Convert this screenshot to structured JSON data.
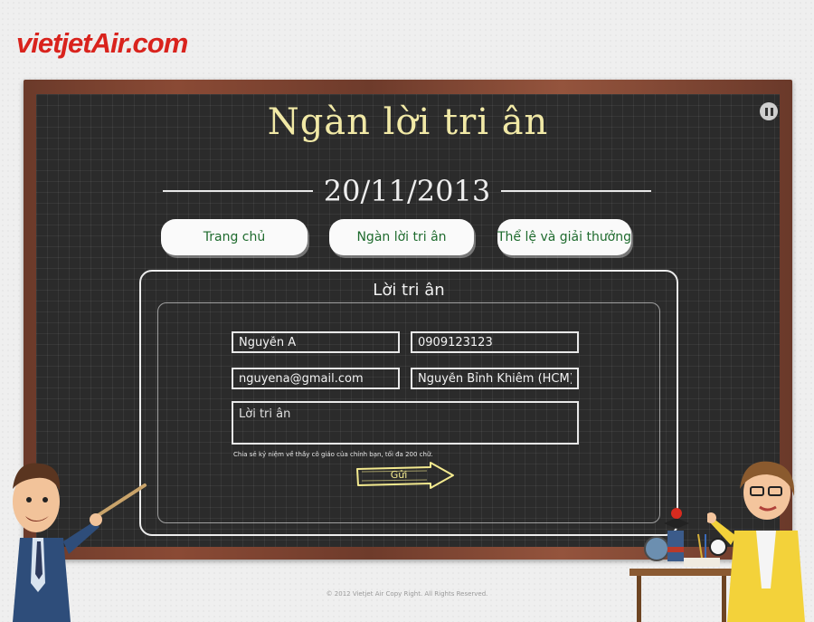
{
  "brand": {
    "logo_text": "vietjetAir.com",
    "accent": "#d9231d"
  },
  "header": {
    "title": "Ngàn lời tri ân",
    "date": "20/11/2013"
  },
  "nav": {
    "tabs": [
      {
        "label": "Trang chủ"
      },
      {
        "label": "Ngàn lời tri ân"
      },
      {
        "label": "Thể lệ và giải thưởng"
      }
    ]
  },
  "controls": {
    "pause_icon": "pause-icon"
  },
  "form": {
    "title": "Lời tri ân",
    "name": {
      "value": "Nguyễn A"
    },
    "phone": {
      "value": "0909123123"
    },
    "email": {
      "value": "nguyena@gmail.com"
    },
    "school": {
      "value": "Nguyễn Bỉnh Khiêm (HCM)"
    },
    "message": {
      "placeholder": "Lời tri ân"
    },
    "hint": "Chia sẻ kỷ niệm về thầy cô giáo của chính bạn, tối đa 200 chữ.",
    "submit_label": "Gửi"
  },
  "footer": {
    "copyright": "© 2012 Vietjet Air Copy Right. All Rights Reserved."
  },
  "colors": {
    "board": "#2b2b2b",
    "frame": "#7a4130",
    "title_yellow": "#f1e9a6",
    "tab_text": "#1f6b2e"
  }
}
